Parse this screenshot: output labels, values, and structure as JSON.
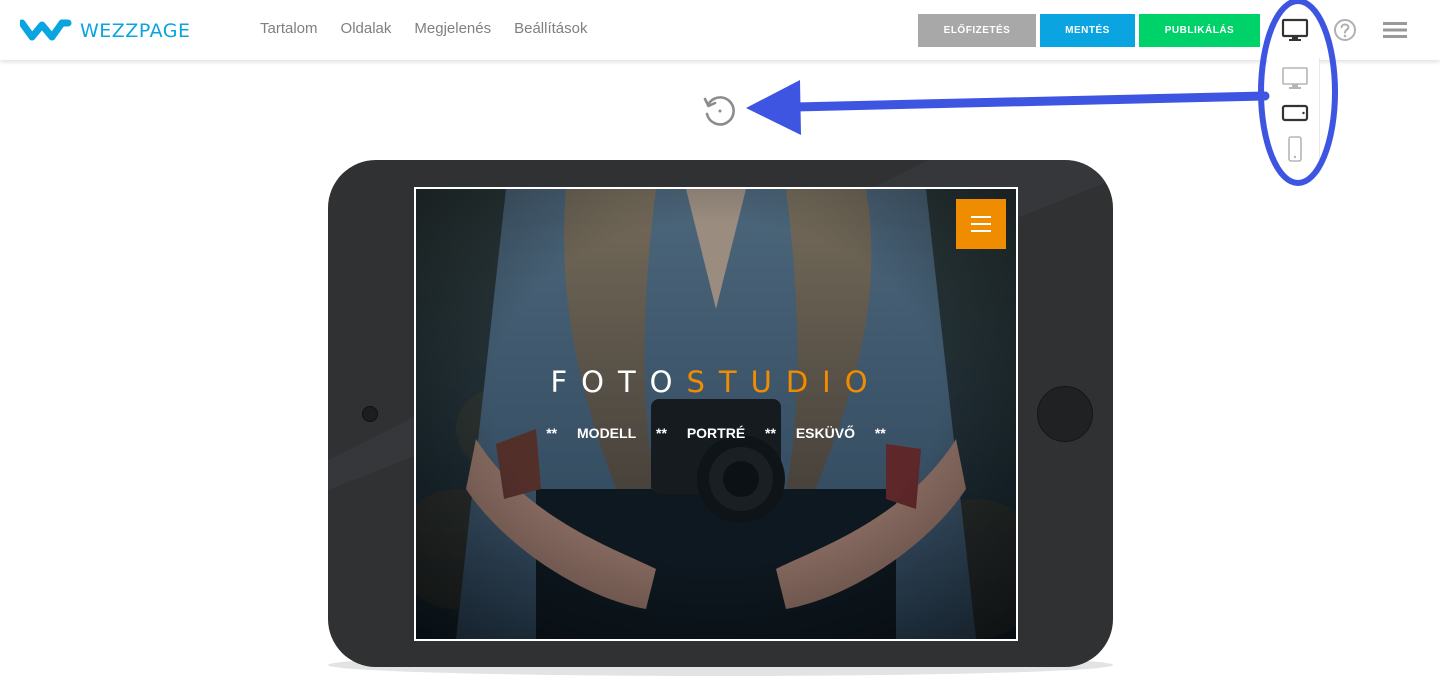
{
  "app": {
    "name": "WEZZPAGE"
  },
  "nav": {
    "items": [
      "Tartalom",
      "Oldalak",
      "Megjelenés",
      "Beállítások"
    ]
  },
  "toolbar": {
    "subscribe_label": "ELŐFIZETÉS",
    "save_label": "MENTÉS",
    "publish_label": "PUBLIKÁLÁS"
  },
  "icons": {
    "current_device": "desktop-icon",
    "help": "help-icon",
    "menu": "hamburger-menu-icon",
    "rotate": "rotate-icon"
  },
  "device_menu": {
    "options": [
      "desktop",
      "tablet",
      "mobile"
    ],
    "selected": "tablet"
  },
  "preview": {
    "brand_part1": "FOTO",
    "brand_part2": "STUDIO",
    "tagline": [
      "**",
      "MODELL",
      "**",
      "PORTRÉ",
      "**",
      "ESKÜVŐ",
      "**"
    ]
  },
  "colors": {
    "brand_blue": "#0aa4e1",
    "publish_green": "#00d26a",
    "subscribe_gray": "#a8a8a8",
    "accent_orange": "#f08c00",
    "annotation_blue": "#3d55e0"
  }
}
